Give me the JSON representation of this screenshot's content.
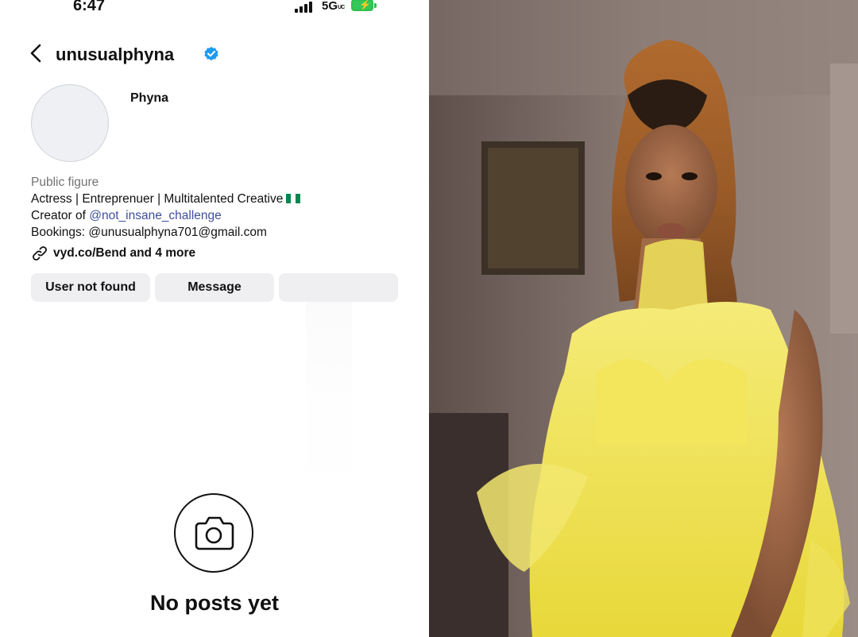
{
  "status_bar": {
    "time": "6:47",
    "network": "5G",
    "network_suffix": "UC"
  },
  "header": {
    "username": "unusualphyna",
    "icons": [
      "back-chevron-icon",
      "verified-badge-icon"
    ]
  },
  "profile": {
    "display_name": "Phyna",
    "category": "Public figure",
    "bio_line1": "Actress | Entreprenuer | Multitalented Creative",
    "bio_line2_prefix": "Creator of ",
    "bio_line2_mention": "@not_insane_challenge",
    "bio_line3": "Bookings: @unusualphyna701@gmail.com",
    "link_text": "vyd.co/Bend and 4 more",
    "flag": "nigeria-flag"
  },
  "buttons": {
    "user_not_found": "User not found",
    "message": "Message",
    "third": ""
  },
  "empty_state": {
    "icon": "camera-icon",
    "label": "No posts yet"
  },
  "colors": {
    "mention": "#3e4f9c",
    "verified": "#1d9bf0",
    "category": "#737373",
    "button_bg": "#efeff1",
    "dress": "#f2e34a",
    "battery": "#34c759"
  }
}
